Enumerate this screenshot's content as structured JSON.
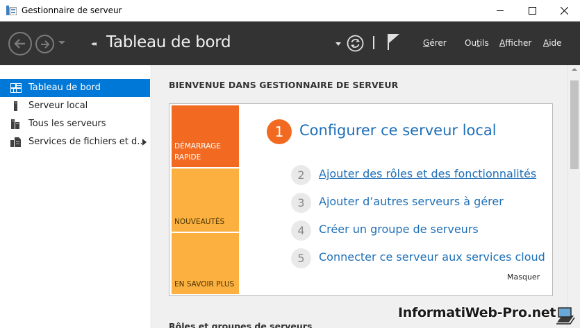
{
  "window": {
    "title": "Gestionnaire de serveur",
    "app_icon": "server-manager-icon",
    "controls": [
      "minimize-icon",
      "maximize-icon",
      "close-icon"
    ]
  },
  "toolbar": {
    "breadcrumb_arrows": "◂◂",
    "title": "Tableau de bord",
    "menu": [
      {
        "pre": "",
        "u": "G",
        "post": "érer"
      },
      {
        "pre": "Ou",
        "u": "t",
        "post": "ils"
      },
      {
        "pre": "",
        "u": "A",
        "post": "fficher"
      },
      {
        "pre": "",
        "u": "A",
        "post": "ide"
      }
    ],
    "icons": [
      "back-arrow-icon",
      "forward-arrow-icon",
      "refresh-icon",
      "flag-icon"
    ]
  },
  "sidebar": {
    "items": [
      {
        "label": "Tableau de bord",
        "icon": "dashboard-grid-icon",
        "active": true
      },
      {
        "label": "Serveur local",
        "icon": "server-icon",
        "active": false
      },
      {
        "label": "Tous les serveurs",
        "icon": "servers-icon",
        "active": false
      },
      {
        "label": "Services de fichiers et d...",
        "icon": "file-services-icon",
        "active": false,
        "expandable": true
      }
    ]
  },
  "main": {
    "welcome_title": "BIENVENUE DANS GESTIONNAIRE DE SERVEUR",
    "tiles": [
      {
        "label_line1": "DÉMARRAGE",
        "label_line2": "RAPIDE",
        "color": "#f26a21"
      },
      {
        "label_line1": "NOUVEAUTÉS",
        "label_line2": "",
        "color": "#fbb040"
      },
      {
        "label_line1": "EN SAVOIR PLUS",
        "label_line2": "",
        "color": "#fbb040"
      }
    ],
    "steps": [
      {
        "num": "1",
        "label": "Configurer ce serveur local"
      },
      {
        "num": "2",
        "label": "Ajouter des rôles et des fonctionnalités"
      },
      {
        "num": "3",
        "label": "Ajouter d’autres serveurs à gérer"
      },
      {
        "num": "4",
        "label": "Créer un groupe de serveurs"
      },
      {
        "num": "5",
        "label": "Connecter ce serveur aux services cloud"
      }
    ],
    "hide_label": "Masquer",
    "roles_title": "Rôles et groupes de serveurs"
  },
  "watermark": {
    "text": "InformatiWeb-Pro.net"
  },
  "colors": {
    "toolbar_bg": "#333333",
    "active_item": "#0078d7",
    "accent_orange": "#f26a21",
    "tile_yellow": "#fbb040",
    "link_blue": "#1e6fb8"
  }
}
